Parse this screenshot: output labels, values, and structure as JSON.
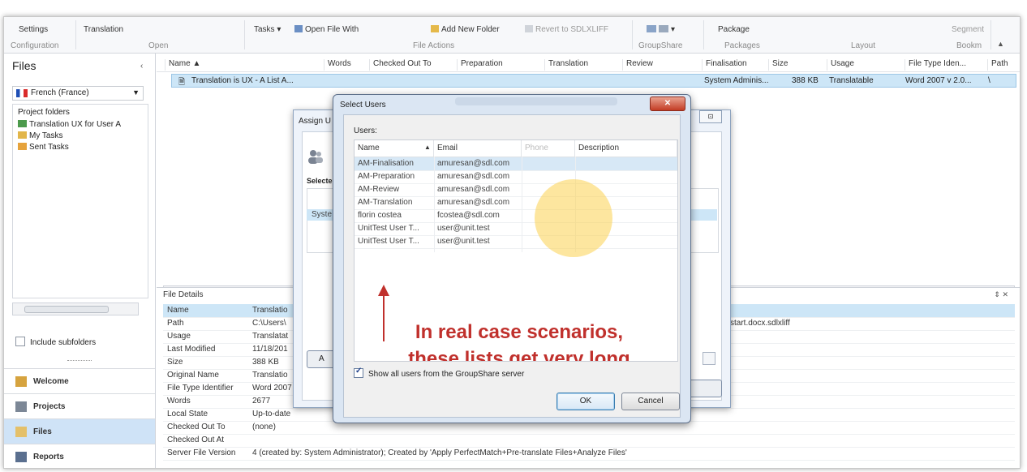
{
  "ribbon": {
    "tabs": [
      "Settings",
      "Translation"
    ],
    "tasks": "Tasks ▾",
    "open_with": "Open File With",
    "add_folder": "Add New Folder",
    "revert": "Revert to SDLXLIFF",
    "groupshare_btn": "▾",
    "package": "Package",
    "segment": "Segment",
    "groups": [
      "Configuration",
      "Open",
      "File Actions",
      "GroupShare",
      "Packages",
      "Layout",
      "Bookm"
    ]
  },
  "left": {
    "title": "Files",
    "collapse": "‹",
    "language": "French (France)",
    "folders_label": "Project folders",
    "folders": [
      "Translation UX for User A",
      "My Tasks",
      "Sent Tasks"
    ],
    "include_subfolders": "Include subfolders",
    "nav": [
      "Welcome",
      "Projects",
      "Files",
      "Reports"
    ]
  },
  "grid": {
    "headers": [
      "Name",
      "Words",
      "Checked Out To",
      "Preparation",
      "Translation",
      "Review",
      "Finalisation",
      "Size",
      "Usage",
      "File Type Iden...",
      "Path"
    ],
    "row": {
      "name": "Translation is UX - A List A...",
      "finalisation": "System Adminis...",
      "size": "388 KB",
      "usage": "Translatable",
      "file_type": "Word 2007 v 2.0...",
      "path": "\\"
    }
  },
  "details": {
    "title": "File Details",
    "controls": "⇕ ✕",
    "rows": [
      {
        "label": "Name",
        "value": "Translatio"
      },
      {
        "label": "Path",
        "value": "C:\\Users\\"
      },
      {
        "label": "Usage",
        "value": "Translatat"
      },
      {
        "label": "Last Modified",
        "value": "11/18/201"
      },
      {
        "label": "Size",
        "value": "388 KB"
      },
      {
        "label": "Original Name",
        "value": "Translatio"
      },
      {
        "label": "File Type Identifier",
        "value": "Word 2007"
      },
      {
        "label": "Words",
        "value": "2677"
      },
      {
        "label": "Local State",
        "value": "Up-to-date"
      },
      {
        "label": "Checked Out To",
        "value": "(none)"
      },
      {
        "label": "Checked Out At",
        "value": ""
      },
      {
        "label": "Server File Version",
        "value": "4 (created by: System Administrator); Created by 'Apply PerfectMatch+Pre-translate Files+Analyze Files'"
      }
    ],
    "path_tail": "start.docx.sdlxliff"
  },
  "assign": {
    "caption": "Assign U",
    "max": "⊡",
    "selected_label": "Selecte",
    "selected_row": "Syste",
    "button_a": "A"
  },
  "select_users": {
    "title": "Select Users",
    "close": "✕",
    "users_label": "Users:",
    "columns": [
      "Name",
      "Email",
      "Phone",
      "Description"
    ],
    "sort_indicator": "▲",
    "users": [
      {
        "name": "AM-Finalisation",
        "email": "amuresan@sdl.com"
      },
      {
        "name": "AM-Preparation",
        "email": "amuresan@sdl.com"
      },
      {
        "name": "AM-Review",
        "email": "amuresan@sdl.com"
      },
      {
        "name": "AM-Translation",
        "email": "amuresan@sdl.com"
      },
      {
        "name": "florin costea",
        "email": "fcostea@sdl.com"
      },
      {
        "name": "UnitTest User T...",
        "email": "user@unit.test"
      },
      {
        "name": "UnitTest User T...",
        "email": "user@unit.test"
      }
    ],
    "annotation_line1": "In real case scenarios,",
    "annotation_line2": "these lists get very long",
    "show_all": "Show all users from the GroupShare server",
    "ok": "OK",
    "cancel": "Cancel"
  },
  "colors": {
    "annotation": "#c0302c",
    "selection": "#cde6f7",
    "highlight": "#fcd250"
  }
}
